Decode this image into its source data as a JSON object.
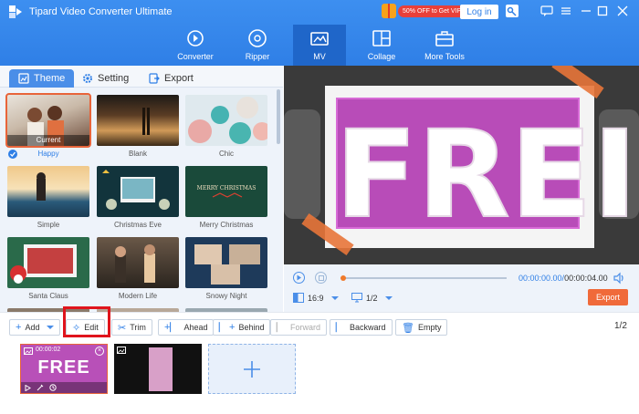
{
  "app": {
    "title": "Tipard Video Converter Ultimate"
  },
  "header": {
    "vip_text": "50% OFF to Get VIP",
    "login_label": "Log in"
  },
  "toolbar": {
    "tabs": [
      {
        "label": "Converter",
        "icon": "converter-icon"
      },
      {
        "label": "Ripper",
        "icon": "disc-icon"
      },
      {
        "label": "MV",
        "icon": "mv-icon",
        "active": true
      },
      {
        "label": "Collage",
        "icon": "collage-icon"
      },
      {
        "label": "More Tools",
        "icon": "toolbox-icon"
      }
    ]
  },
  "left_tabs": [
    {
      "label": "Theme",
      "active": true
    },
    {
      "label": "Setting"
    },
    {
      "label": "Export"
    }
  ],
  "themes": [
    {
      "label": "Happy",
      "overlay": "Current",
      "selected": true
    },
    {
      "label": "Blank"
    },
    {
      "label": "Chic"
    },
    {
      "label": "Simple"
    },
    {
      "label": "Christmas Eve"
    },
    {
      "label": "Merry Christmas"
    },
    {
      "label": "Santa Claus"
    },
    {
      "label": "Modern Life"
    },
    {
      "label": "Snowy Night"
    }
  ],
  "preview": {
    "text": "FREI",
    "thumb_christmas_text": "MERRY CHRISTMAS"
  },
  "playback": {
    "current_time": "00:00:00.00",
    "total_time": "00:00:04.00",
    "aspect_ratio": "16:9",
    "page": "1/2",
    "export_label": "Export"
  },
  "edit_toolbar": {
    "add": "Add",
    "edit": "Edit",
    "trim": "Trim",
    "ahead": "Ahead",
    "behind": "Behind",
    "forward": "Forward",
    "backward": "Backward",
    "empty": "Empty",
    "page_count": "1/2"
  },
  "timeline": {
    "clip1_duration": "00:00:02",
    "clip1_text": "FREE"
  },
  "colors": {
    "accent": "#2f7fe6",
    "export": "#f06a3a",
    "highlight": "#e0141c"
  }
}
